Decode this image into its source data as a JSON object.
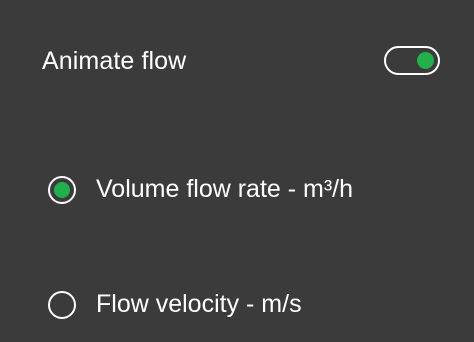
{
  "animate_flow": {
    "label": "Animate flow",
    "enabled": true
  },
  "flow_display": {
    "options": [
      {
        "label": "Volume flow rate - m³/h",
        "selected": true
      },
      {
        "label": "Flow velocity - m/s",
        "selected": false
      }
    ]
  },
  "colors": {
    "background": "#3b3b3b",
    "accent_green": "#21b04b",
    "text": "#ffffff"
  },
  "icons": {
    "toggle": "toggle-switch-on",
    "radio_selected": "radio-selected-icon",
    "radio_unselected": "radio-unselected-icon"
  }
}
